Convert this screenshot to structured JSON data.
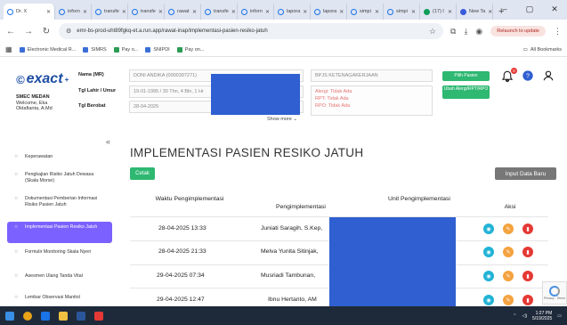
{
  "browser": {
    "tabs": [
      {
        "label": "Dr. X",
        "active": true
      },
      {
        "label": "inforn"
      },
      {
        "label": "transfe"
      },
      {
        "label": "transfe"
      },
      {
        "label": "rawat"
      },
      {
        "label": "transfe"
      },
      {
        "label": "inforn"
      },
      {
        "label": "lapora"
      },
      {
        "label": "lapora"
      },
      {
        "label": "simpi"
      },
      {
        "label": "simpi"
      },
      {
        "label": "(17) I"
      },
      {
        "label": "New Ta"
      }
    ],
    "url": "emr-bs-prod-uht89fgkq-et.a.run.app/rawat-inap/implementasi-pasien-resiko-jatuh",
    "update_label": "Relaunch to update",
    "bookmarks": [
      "Electronic Medical R...",
      "SIMRS",
      "Pay o...",
      "SNIPDI",
      "Pay on..."
    ],
    "all_bookmarks": "All Bookmarks"
  },
  "app": {
    "logo": "exact",
    "unit": "SMEC MEDAN",
    "welcome": "Welcome, Eka Oktafianta, A.Md",
    "patient": {
      "name_label": "Nama (MR)",
      "name_value": "DONI ANDIKA (0000397271)",
      "dob_label": "Tgl Lahir / Umur",
      "dob_value": "19-01-1995 / 30 Thn, 4 Bln, 1 Hr",
      "date_label": "Tgl Berobat",
      "date_value": "28-04-2025",
      "payer": "BPJS KETENAGAKERJAAN",
      "allergies": [
        "Alergi: Tidak Ada",
        "RPT: Tidak Ada",
        "RPO: Tidak Ada"
      ],
      "pilih_pasien": "Pilih Pasien",
      "ubah_alergi": "Ubah Alergi/RPT/RPO",
      "show_more": "Show more ⌄"
    },
    "notif_count": "0"
  },
  "sidebar": {
    "items": [
      {
        "label": "Keperawatan",
        "marker": "○"
      },
      {
        "label": "Pengkajian Risiko Jatuh Dewasa (Skala Morse)",
        "marker": "○"
      },
      {
        "label": "Dokumentasi Pemberian Informasi Risiko Pasien Jatuh",
        "marker": "○"
      },
      {
        "label": "Implementasi Pasien Resiko Jatuh",
        "marker": "○",
        "active": true
      },
      {
        "label": "Formulir Monitoring Skala Nyeri",
        "marker": "○"
      },
      {
        "label": "Asesmen Ulang Tanda Vital",
        "marker": "○"
      },
      {
        "label": "Lembar Observasi Manitol",
        "marker": "○"
      }
    ]
  },
  "main": {
    "title": "IMPLEMENTASI PASIEN RESIKO JATUH",
    "cetak": "Cetak",
    "input_baru": "Input Data Baru",
    "columns": [
      "Waktu Pengimplementasi",
      "Pengimplementasi",
      "Unit Pengimplementasi",
      "Aksi"
    ],
    "rows": [
      {
        "waktu": "28-04-2025 13:33",
        "oleh": "Juniati Saragih, S.Kep,"
      },
      {
        "waktu": "28-04-2025 21:33",
        "oleh": "Melva Yunita Sitinjak,"
      },
      {
        "waktu": "29-04-2025 07:34",
        "oleh": "Musriadi Tambunan,"
      },
      {
        "waktu": "29-04-2025 12:47",
        "oleh": "Ibnu Hertanto, AM"
      }
    ]
  },
  "recaptcha": "Privacy - Terms",
  "taskbar": {
    "time": "1:27 PM",
    "date": "5/19/2025"
  },
  "colors": {
    "accent": "#7b61ff",
    "green": "#2eb872",
    "redaction": "#2f5fd1"
  }
}
